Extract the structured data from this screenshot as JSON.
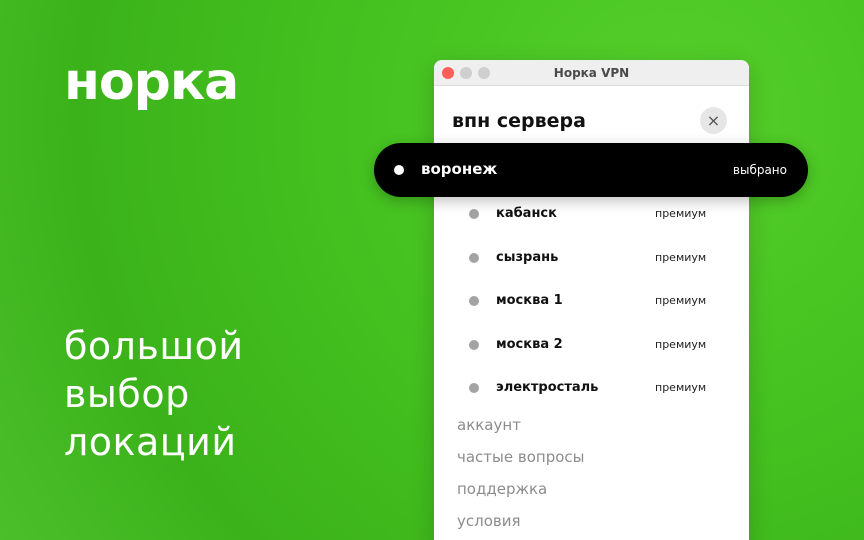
{
  "logo": "норка",
  "tagline": [
    "большой",
    "выбор",
    "локаций"
  ],
  "window": {
    "title": "Норка VPN",
    "panel_title": "впн сервера",
    "close_icon": "×",
    "selected": {
      "name": "воронеж",
      "tag": "выбрано"
    },
    "servers": [
      {
        "name": "кабанск",
        "tag": "премиум"
      },
      {
        "name": "сызрань",
        "tag": "премиум"
      },
      {
        "name": "москва 1",
        "tag": "премиум"
      },
      {
        "name": "москва 2",
        "tag": "премиум"
      },
      {
        "name": "электросталь",
        "tag": "премиум"
      }
    ],
    "menu": [
      "аккаунт",
      "частые вопросы",
      "поддержка",
      "условия"
    ]
  },
  "colors": {
    "background": "#45c220",
    "selected_bg": "#000000",
    "inactive_bullet": "#a3a3a3",
    "close_red": "#ff5f57"
  }
}
